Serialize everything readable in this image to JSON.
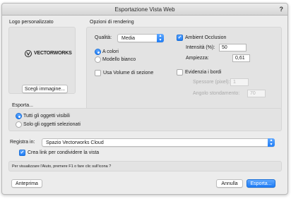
{
  "window": {
    "title": "Esportazione Vista Web",
    "help": "?"
  },
  "logo_section": {
    "label": "Logo personalizzato",
    "logo_text": "VECTORWORKS",
    "choose_button": "Scegli immagine..."
  },
  "render_options": {
    "label": "Opzioni di rendering",
    "quality_label": "Qualità:",
    "quality_value": "Media",
    "color_mode": [
      {
        "label": "A colori",
        "selected": true
      },
      {
        "label": "Modello bianco",
        "selected": false
      }
    ],
    "use_section_volume": {
      "label": "Usa Volume di sezione",
      "checked": false
    },
    "ambient_occlusion": {
      "label": "Ambient Occlusion",
      "checked": true
    },
    "intensity_label": "Intensità (%):",
    "intensity_value": "50",
    "width_label": "Ampiezza:",
    "width_value": "0,61",
    "edges": {
      "label": "Evidenzia i bordi",
      "checked": false
    },
    "thickness_label": "Spessore (pixel):",
    "thickness_value": "1",
    "smoothing_label": "Angolo stondamento:",
    "smoothing_value": "70"
  },
  "export_section": {
    "label": "Esporta...",
    "options": [
      {
        "label": "Tutti gli oggetti visibili",
        "selected": true
      },
      {
        "label": "Solo gli oggetti selezionati",
        "selected": false
      }
    ]
  },
  "register": {
    "label": "Registra in:",
    "value": "Spazio Vectorworks Cloud",
    "share_link": {
      "label": "Crea link per condividere la vista",
      "checked": true
    }
  },
  "help_text": "Per visualizzare l'Aiuto, premere F1 o fare clic sull'icona ?",
  "buttons": {
    "preview": "Anteprima",
    "cancel": "Annulla",
    "export": "Esporta..."
  },
  "colors": {
    "accent": "#1f7cf5",
    "panel": "#e3e3e3",
    "window": "#ececec"
  }
}
